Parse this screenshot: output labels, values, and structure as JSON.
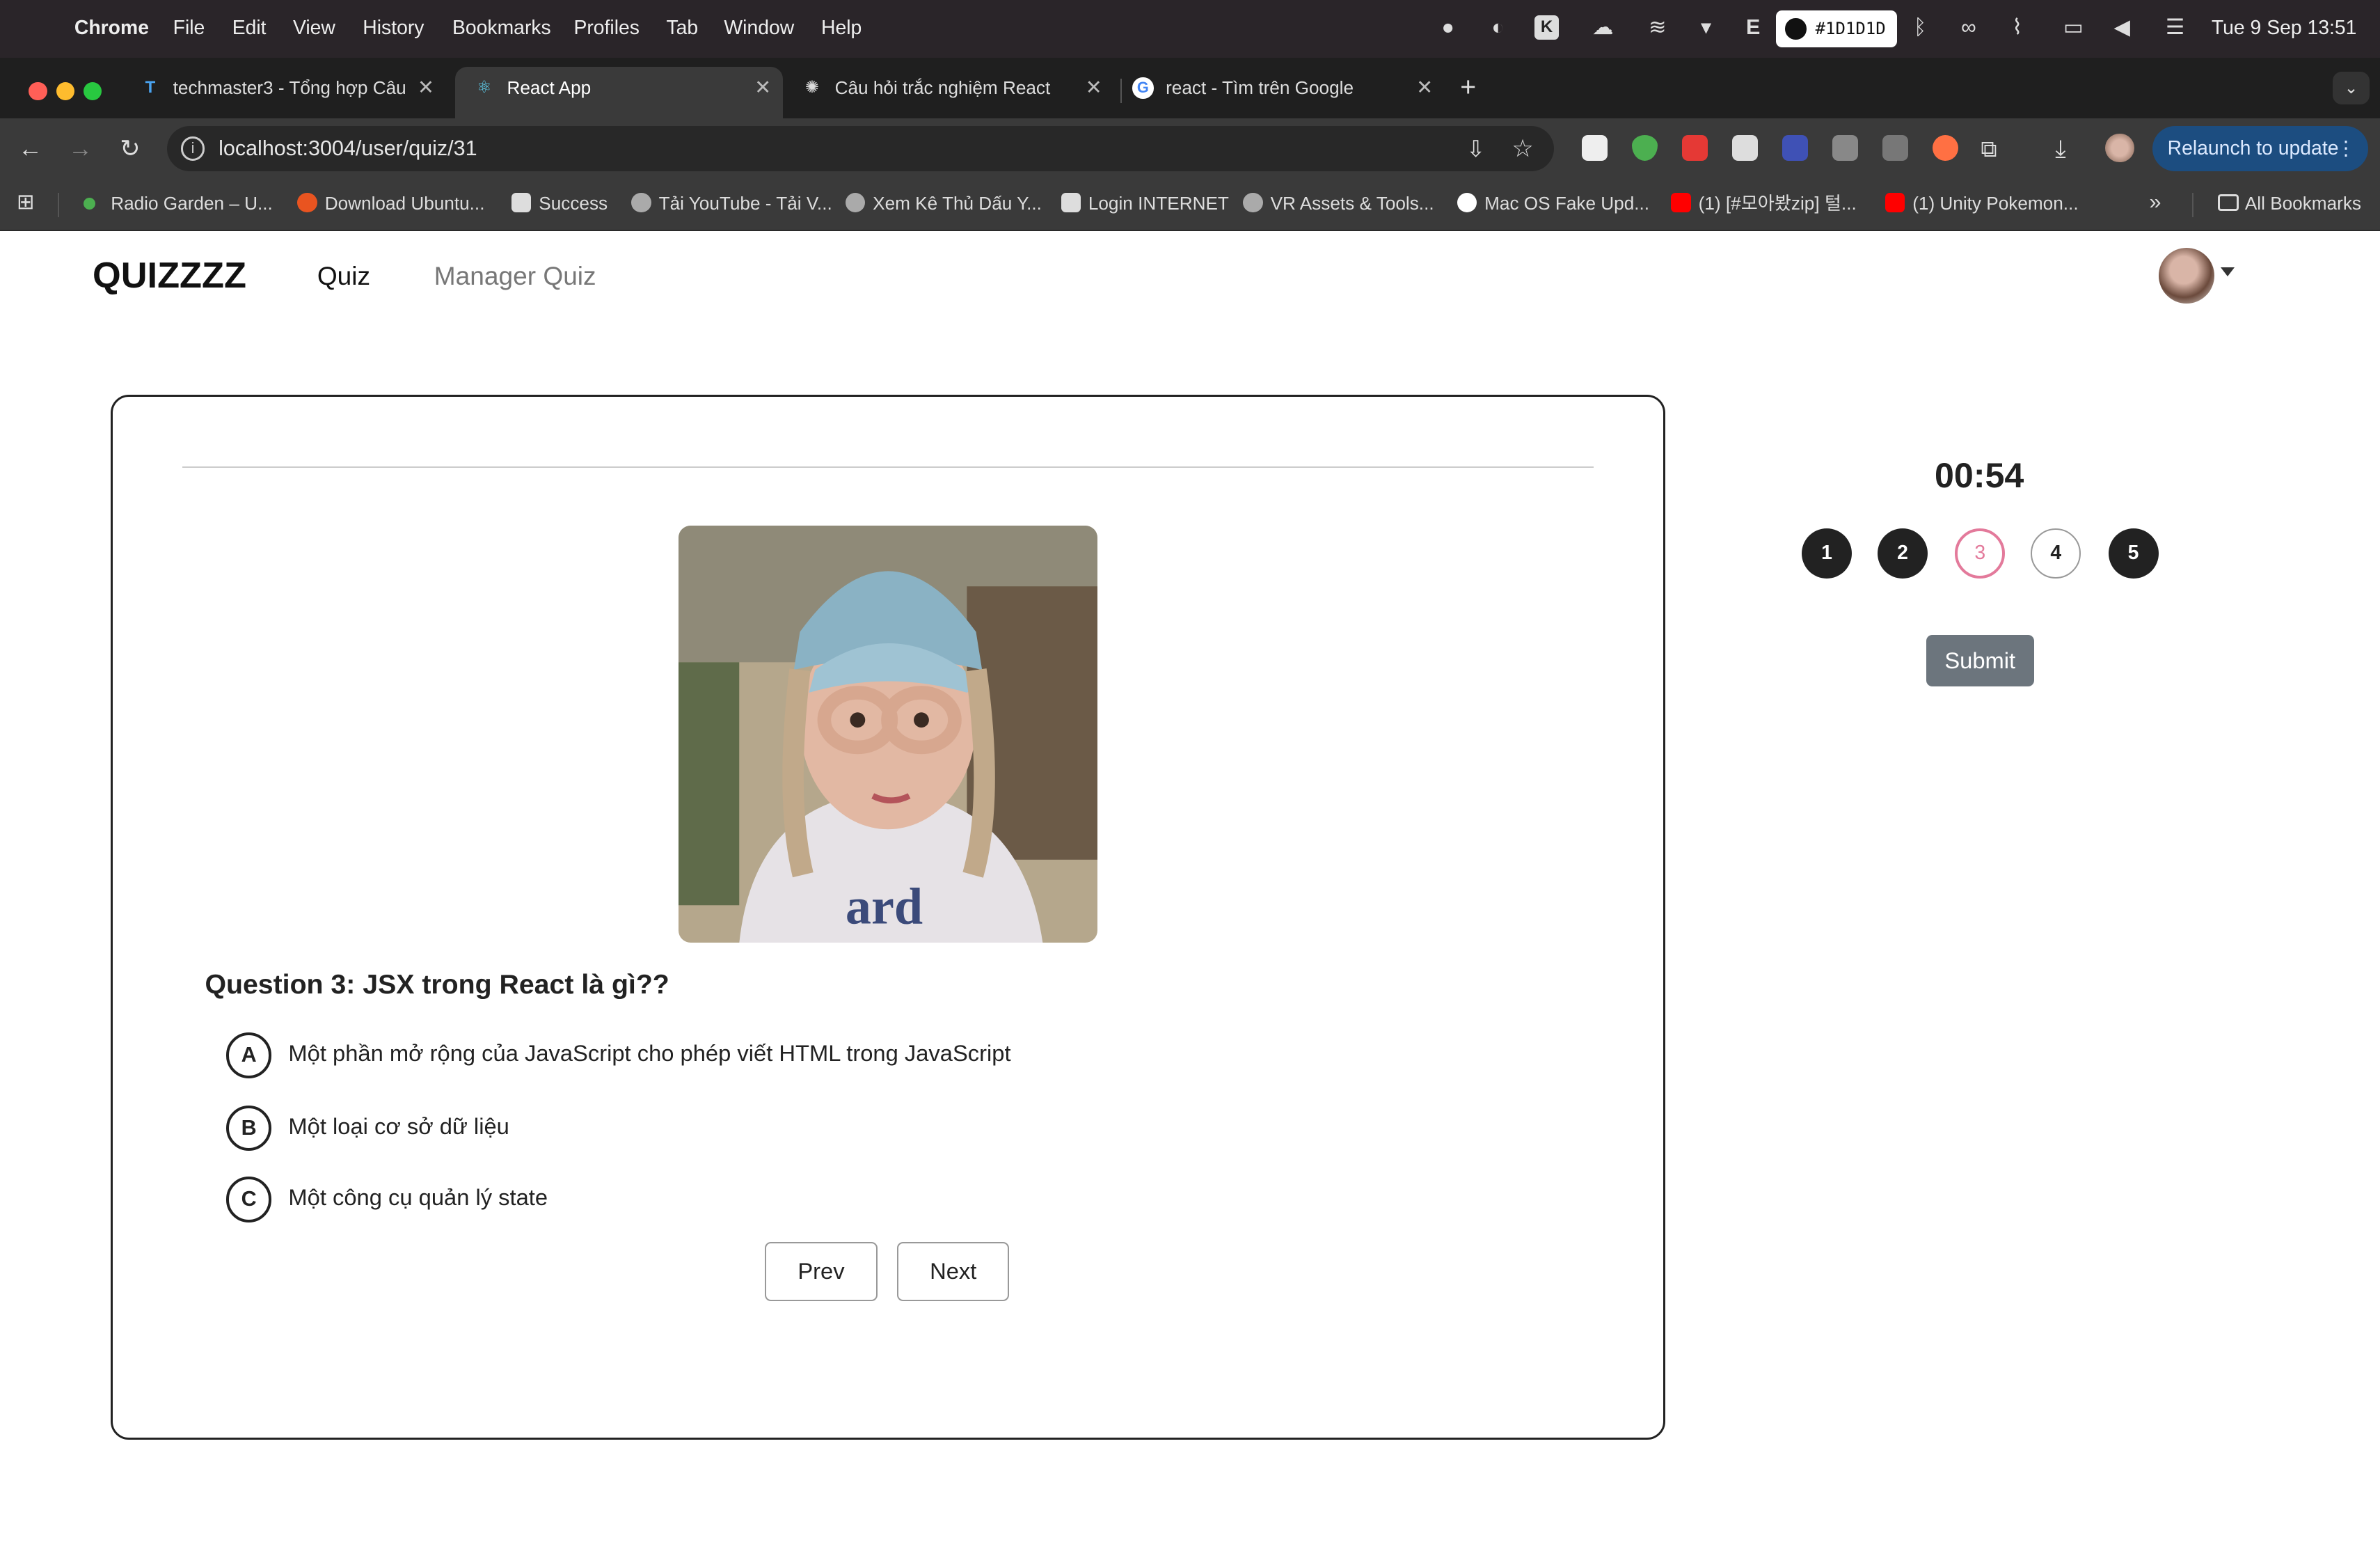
{
  "menubar": {
    "apple": "",
    "app": "Chrome",
    "items": [
      "File",
      "Edit",
      "View",
      "History",
      "Bookmarks",
      "Profiles",
      "Tab",
      "Window",
      "Help"
    ],
    "hex": "#1D1D1D",
    "tray_letter": "E",
    "clock": "Tue 9 Sep  13:51"
  },
  "tabs": [
    {
      "title": "techmaster3 - Tổng hợp Câu",
      "icon": "techmaster-icon"
    },
    {
      "title": "React App",
      "icon": "react-icon"
    },
    {
      "title": "Câu hỏi trắc nghiệm React",
      "icon": "chatgpt-icon"
    },
    {
      "title": "react - Tìm trên Google",
      "icon": "google-icon"
    }
  ],
  "toolbar": {
    "url": "localhost:3004/user/quiz/31",
    "relaunch": "Relaunch to update"
  },
  "bookmarks": [
    "Radio Garden – U...",
    "Download Ubuntu...",
    "Success",
    "Tải YouTube - Tải V...",
    "Xem Kê Thủ Dấu Y...",
    "Login INTERNET",
    "VR Assets & Tools...",
    "Mac OS Fake Upd...",
    "(1) [#모아봤zip] 털...",
    "(1) Unity Pokemon..."
  ],
  "all_bookmarks": "All Bookmarks",
  "header": {
    "logo": "QUIZZZZ",
    "nav": [
      "Quiz",
      "Manager Quiz"
    ]
  },
  "quiz": {
    "question": "Question 3: JSX trong React là gì??",
    "answers": [
      {
        "letter": "A",
        "text": "Một phần mở rộng của JavaScript cho phép viết HTML trong JavaScript"
      },
      {
        "letter": "B",
        "text": "Một loại cơ sở dữ liệu"
      },
      {
        "letter": "C",
        "text": "Một công cụ quản lý state"
      }
    ],
    "prev": "Prev",
    "next": "Next"
  },
  "sidebar": {
    "timer": "00:54",
    "questions": [
      {
        "n": "1",
        "state": "done"
      },
      {
        "n": "2",
        "state": "done"
      },
      {
        "n": "3",
        "state": "current"
      },
      {
        "n": "4",
        "state": "todo"
      },
      {
        "n": "5",
        "state": "done"
      }
    ],
    "submit": "Submit"
  },
  "colors": {
    "current_question": "#e37a9b",
    "submit_bg": "#6c757d",
    "relaunch_bg": "#1c4d80"
  }
}
